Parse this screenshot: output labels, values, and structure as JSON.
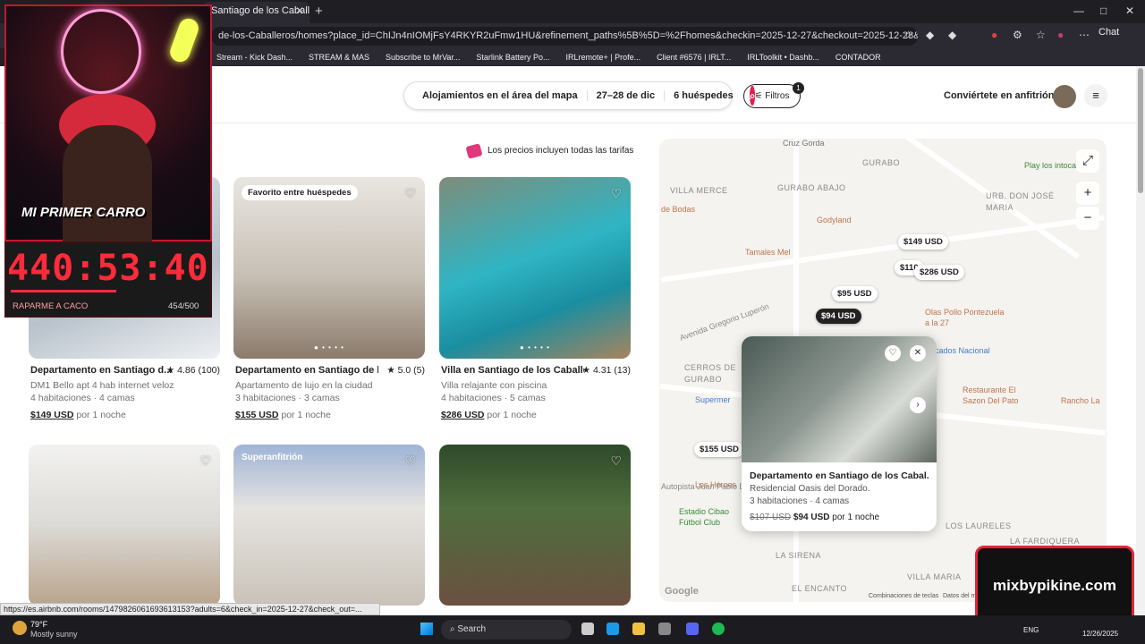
{
  "browser": {
    "tab_title": "Santiago de los Caballeros",
    "tab_close": "✕",
    "new_tab": "+",
    "url": "de-los-Caballeros/homes?place_id=ChIJn4nIOMjFsY4RKYR2uFmw1HU&refinement_paths%5B%5D=%2Fhomes&checkin=2025-12-27&checkout=2025-12-28&date_picker_type=ca...",
    "chat_label": "Chat",
    "bookmarks": [
      "Stream - Kick Dash...",
      "STREAM & MAS",
      "Subscribe to MrVar...",
      "Starlink Battery Po...",
      "IRLremote+ | Profe...",
      "Client #6576 | IRLT...",
      "IRLToolkit • Dashb...",
      "CONTADOR"
    ]
  },
  "header": {
    "search_where": "Alojamientos en el área del mapa",
    "search_dates": "27–28 de dic",
    "search_guests": "6 huéspedes",
    "filters_label": "Filtros",
    "filters_count": "1",
    "host_link": "Conviértete en anfitrión"
  },
  "fees_notice": "Los precios incluyen todas las tarifas",
  "listings": [
    {
      "title": "Departamento en Santiago d...",
      "rating": "★ 4.86 (100)",
      "subtitle": "DM1 Bello apt 4 hab internet veloz",
      "rooms": "4 habitaciones · 4 camas",
      "price": "$149 USD",
      "per": "por 1 noche"
    },
    {
      "badge": "Favorito entre huéspedes",
      "title": "Departamento en Santiago de lo...",
      "rating": "★ 5.0 (5)",
      "subtitle": "Apartamento de lujo en la ciudad",
      "rooms": "3 habitaciones · 3 camas",
      "price": "$155 USD",
      "per": "por 1 noche"
    },
    {
      "title": "Villa en Santiago de los Caballe...",
      "rating": "★ 4.31 (13)",
      "subtitle": "Villa relajante con piscina",
      "rooms": "4 habitaciones · 5 camas",
      "price": "$286 USD",
      "per": "por 1 noche"
    },
    {},
    {
      "badge": "Superanfitrión"
    },
    {}
  ],
  "map": {
    "labels": [
      "GURABO",
      "GURABO ABAJO",
      "URB. DON JOSÉ MARIA",
      "VILLA MERCE",
      "CERROS DE GURABO",
      "VILLA MARIA",
      "LOS LAURELES",
      "LA FARDIQUERA",
      "EL ENCANTO",
      "LA SIRENA"
    ],
    "places": [
      "Cruz Gorda",
      "Play los intocables",
      "Godyland",
      "Tamales Mel",
      "Olas Pollo Pontezuela a la 27",
      "Restaurante El Sazon Del Pato",
      "Rancho La",
      "Estadio Cibao Fútbol Club",
      "Los Héroes",
      "Supermer",
      "de Bodas",
      "cados Nacional",
      "Avenida Gregorio Luperón",
      "Autopista Juan Pablo Duarte"
    ],
    "pins": [
      "$149 USD",
      "$110",
      "$286 USD",
      "$95 USD",
      "$94 USD",
      "$155 USD"
    ],
    "expand_icon": "⤢",
    "zoom_in": "+",
    "zoom_out": "−",
    "google": "Google",
    "attr": "Combinaciones de teclas",
    "attr2": "Datos del m"
  },
  "popup": {
    "title": "Departamento en Santiago de los Cabal...",
    "subtitle": "Residencial Oasis del Dorado.",
    "rooms": "3 habitaciones · 4 camas",
    "old_price": "$107 USD",
    "price": "$94 USD",
    "per": "por 1 noche",
    "heart": "♡",
    "close": "✕",
    "next": "›"
  },
  "stream": {
    "car_label": "MI PRIMER CARRO",
    "timer": "440:53:40",
    "timer_label": "RAPARME A CACO",
    "timer_count": "454/500",
    "overlay": "mixbypikine.com"
  },
  "status_url": "https://es.airbnb.com/rooms/1479826061693613153?adults=6&check_in=2025-12-27&check_out=...",
  "taskbar": {
    "temp": "79°F",
    "weather": "Mostly sunny",
    "search": "Search",
    "lang": "ENG",
    "date": "12/26/2025"
  },
  "colors": {
    "brand": "#e61e4d",
    "timer": "#ff2b3b",
    "overlay_border": "#e52335"
  }
}
